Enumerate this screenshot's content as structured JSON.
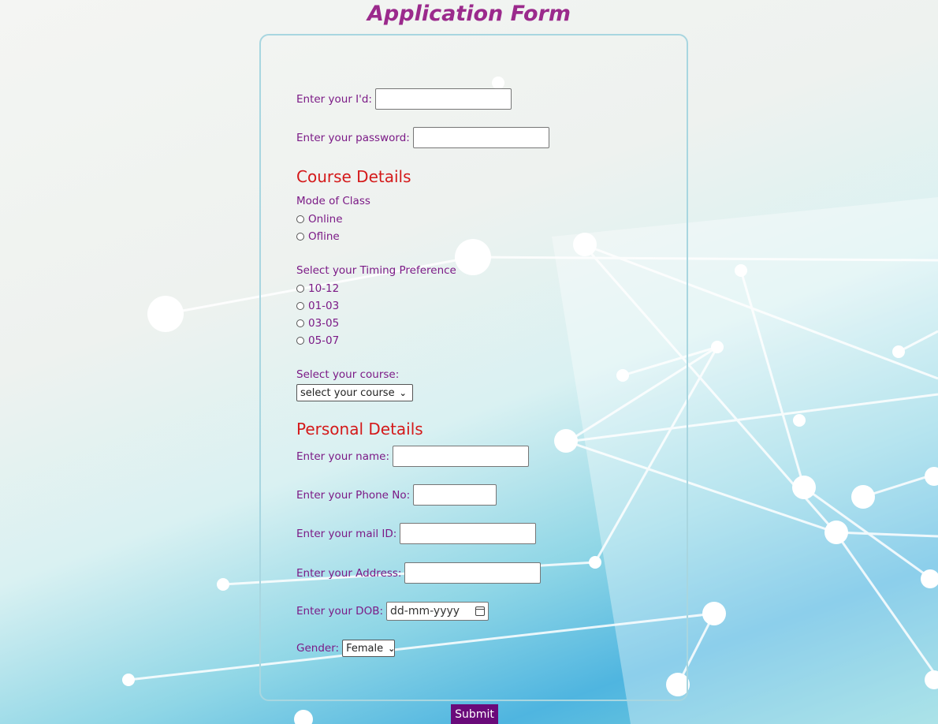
{
  "page": {
    "title": "Application Form"
  },
  "login": {
    "id_label": "Enter your I'd:",
    "id_value": "",
    "password_label": "Enter your password:",
    "password_value": ""
  },
  "course_details": {
    "heading": "Course Details",
    "mode_label": "Mode of Class",
    "mode_options": [
      "Online",
      "Ofline"
    ],
    "timing_label": "Select your Timing Preference",
    "timing_options": [
      "10-12",
      "01-03",
      "03-05",
      "05-07"
    ],
    "course_label": "Select your course:",
    "course_selected": "select your course"
  },
  "personal_details": {
    "heading": "Personal Details",
    "name_label": "Enter your name:",
    "phone_label": "Enter your Phone No:",
    "mail_label": "Enter your mail ID:",
    "address_label": "Enter your Address:",
    "dob_label": "Enter your DOB:",
    "dob_placeholder": "dd-mm-yyyy",
    "gender_label": "Gender:",
    "gender_selected": "Female"
  },
  "actions": {
    "submit_label": "Submit"
  },
  "colors": {
    "title": "#9b2a8c",
    "label": "#7b1a86",
    "section": "#d4191a",
    "submit_bg": "#6a0a7a"
  }
}
